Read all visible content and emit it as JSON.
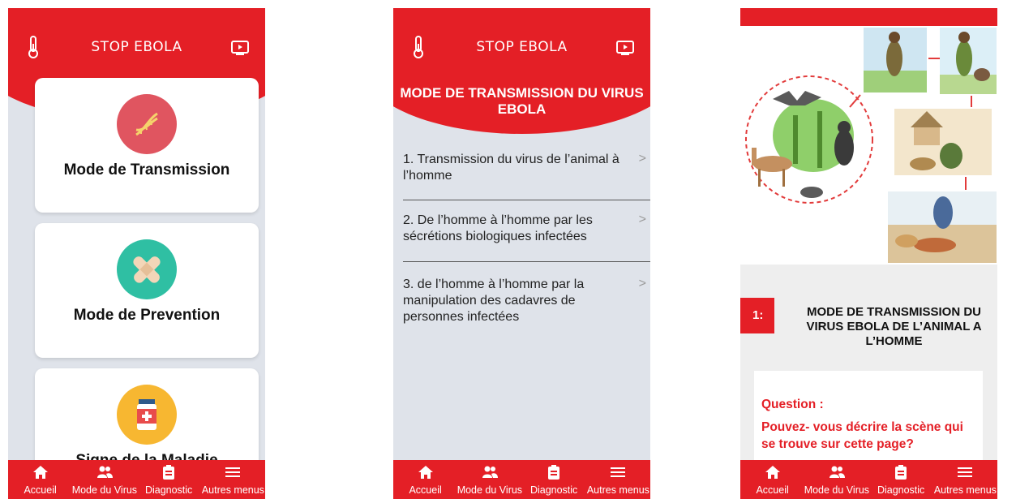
{
  "app": {
    "title": "STOP  EBOLA",
    "brand_color": "#e41f26"
  },
  "nav": {
    "items": [
      {
        "label": "Accueil",
        "icon": "home-icon"
      },
      {
        "label": "Mode du Virus",
        "icon": "people-icon"
      },
      {
        "label": "Diagnostic",
        "icon": "clipboard-icon"
      },
      {
        "label": "Autres menus",
        "icon": "menu-icon"
      }
    ]
  },
  "screen1": {
    "cards": [
      {
        "label": "Mode de Transmission",
        "icon": "dna-icon",
        "color": "#e05560"
      },
      {
        "label": "Mode de Prevention",
        "icon": "bandage-icon",
        "color": "#2fbfa3"
      },
      {
        "label": "Signe de la Maladie",
        "icon": "medicine-bottle-icon",
        "color": "#f7b731"
      }
    ]
  },
  "screen2": {
    "banner_line1": "MODE DE TRANSMISSION DU VIRUS",
    "banner_line2": "EBOLA",
    "items": [
      {
        "text": "1. Transmission du virus de l’animal à l’homme"
      },
      {
        "text": "2. De l’homme à l’homme par les sécrétions biologiques infectées"
      },
      {
        "text": "3.  de l’homme à l’homme par la  manipulation des cadavres de personnes infectées"
      }
    ],
    "chevron": ">"
  },
  "screen3": {
    "step_number": "1:",
    "step_title": "MODE DE TRANSMISSION DU VIRUS EBOLA DE L’ANIMAL A L’HOMME",
    "question_label": "Question :",
    "question_text": "Pouvez- vous décrire la scène qui se trouve sur cette page?"
  }
}
